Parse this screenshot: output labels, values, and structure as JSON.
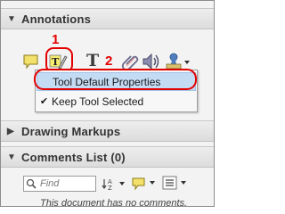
{
  "annotations": {
    "title": "Annotations",
    "collapse_glyph": "▼"
  },
  "tools": [
    {
      "name": "sticky-note-icon"
    },
    {
      "name": "text-edit-highlight-icon"
    },
    {
      "name": "text-box-icon",
      "glyph": "T"
    },
    {
      "name": "attach-file-icon"
    },
    {
      "name": "record-audio-icon"
    },
    {
      "name": "stamp-icon"
    }
  ],
  "callouts": {
    "one": "1",
    "two": "2"
  },
  "context_menu": {
    "items": [
      {
        "label": "Tool Default Properties",
        "checked": false
      },
      {
        "label": "Keep Tool Selected",
        "checked": true,
        "check_glyph": "✔"
      }
    ]
  },
  "drawing_markups": {
    "title": "Drawing Markups",
    "expand_glyph": "▶"
  },
  "comments_list": {
    "title": "Comments List (0)",
    "collapse_glyph": "▼",
    "search_placeholder": "Find",
    "empty_text": "This document has no comments."
  }
}
